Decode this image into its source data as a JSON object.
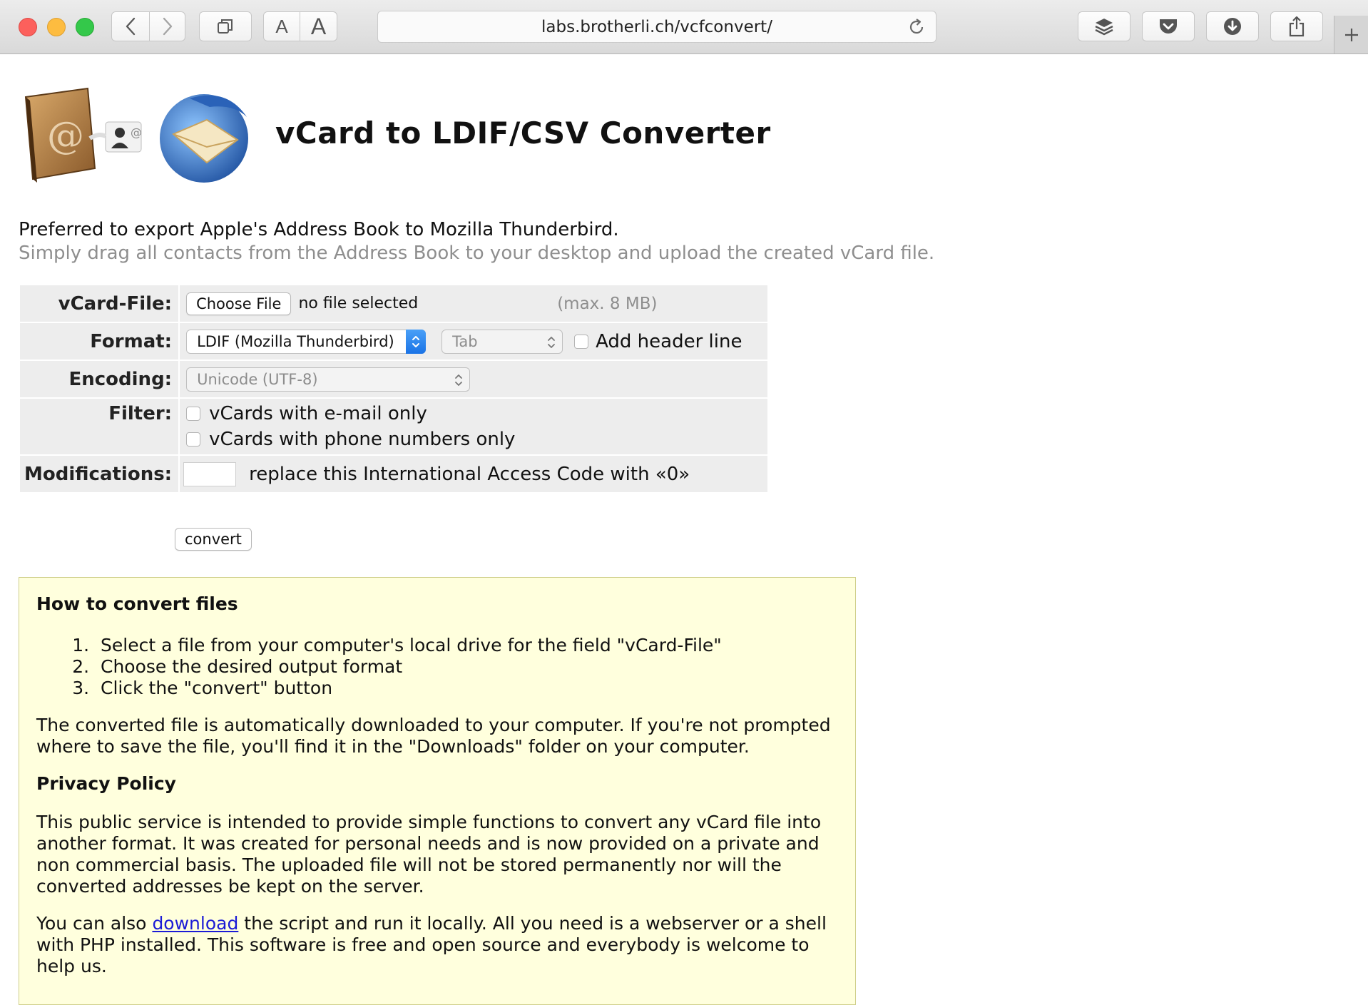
{
  "browser": {
    "url": "labs.brotherli.ch/vcfconvert/",
    "font_small": "A",
    "font_large": "A"
  },
  "page": {
    "title": "vCard to LDIF/CSV Converter",
    "intro_line1": "Preferred to export Apple's Address Book to Mozilla Thunderbird.",
    "intro_line2": "Simply drag all contacts from the Address Book to your desktop and upload the created vCard file."
  },
  "form": {
    "vcard_label": "vCard-File:",
    "choose_file": "Choose File",
    "no_file": "no file selected",
    "max_size": "(max. 8 MB)",
    "format_label": "Format:",
    "format_value": "LDIF (Mozilla Thunderbird)",
    "separator_value": "Tab",
    "add_header": "Add header line",
    "encoding_label": "Encoding:",
    "encoding_value": "Unicode (UTF-8)",
    "filter_label": "Filter:",
    "filter_email": "vCards with e-mail only",
    "filter_phone": "vCards with phone numbers only",
    "modifications_label": "Modifications:",
    "modifications_text": "replace this International Access Code with «0»",
    "convert": "convert"
  },
  "info": {
    "howto_title": "How to convert files",
    "steps": [
      "Select a file from your computer's local drive for the field \"vCard-File\"",
      "Choose the desired output format",
      "Click the \"convert\" button"
    ],
    "download_note": "The converted file is automatically downloaded to your computer. If you're not prompted where to save the file, you'll find it in the \"Downloads\" folder on your computer.",
    "privacy_title": "Privacy Policy",
    "privacy_text": "This public service is intended to provide simple functions to convert any vCard file into another format. It was created for personal needs and is now provided on a private and non commercial basis. The uploaded file will not be stored permanently nor will the converted addresses be kept on the server.",
    "also_prefix": "You can also",
    "download_link": "download",
    "also_suffix": "the script and run it locally. All you need is a webserver or a shell with PHP installed. This software is free and open source and everybody is welcome to help us."
  },
  "colors": {
    "accent": "#1a73e6",
    "info_bg": "#ffffdd",
    "link": "#1b1bd6"
  },
  "icons": [
    "back-icon",
    "forward-icon",
    "tabs-icon",
    "reload-icon",
    "layers-icon",
    "pocket-icon",
    "download-icon",
    "share-icon",
    "plus-icon"
  ]
}
